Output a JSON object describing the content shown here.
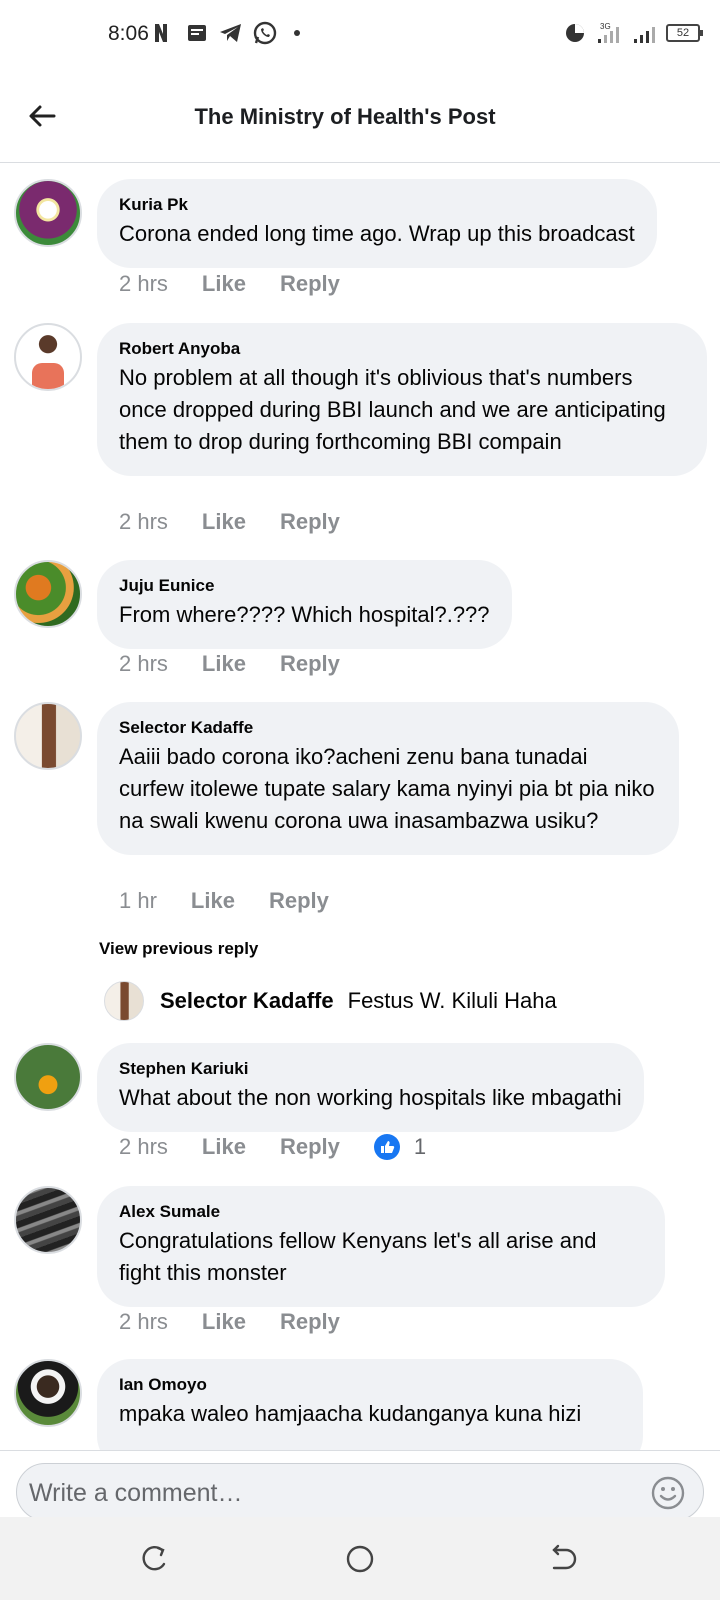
{
  "status_bar": {
    "time": "8:06",
    "battery": "52",
    "network": "3G"
  },
  "header": {
    "title": "The Ministry of Health's Post"
  },
  "comments": [
    {
      "author": "Kuria Pk",
      "text": "Corona ended long time ago. Wrap up this broadcast",
      "time": "2 hrs",
      "like": "Like",
      "reply": "Reply"
    },
    {
      "author": "Robert Anyoba",
      "text": "No problem at all though it's oblivious that's numbers once dropped during BBI launch and we are anticipating them to drop during forthcoming BBI compain",
      "time": "2 hrs",
      "like": "Like",
      "reply": "Reply"
    },
    {
      "author": "Juju Eunice",
      "text": "From where???? Which hospital?.???",
      "time": "2 hrs",
      "like": "Like",
      "reply": "Reply"
    },
    {
      "author": "Selector Kadaffe",
      "text": "Aaiii bado corona iko?acheni zenu bana tunadai curfew itolewe tupate salary kama nyinyi pia bt pia niko na swali kwenu corona uwa inasambazwa usiku?",
      "time": "1 hr",
      "like": "Like",
      "reply": "Reply"
    },
    {
      "author": "Stephen Kariuki",
      "text": "What about the non working hospitals like mbagathi",
      "time": "2 hrs",
      "like": "Like",
      "reply": "Reply",
      "reactions": "1"
    },
    {
      "author": "Alex Sumale",
      "text": "Congratulations fellow Kenyans let's all arise and fight this monster",
      "time": "2 hrs",
      "like": "Like",
      "reply": "Reply"
    },
    {
      "author": "Ian Omoyo",
      "text": "mpaka waleo hamjaacha kudanganya kuna hizi"
    }
  ],
  "thread": {
    "view_previous": "View previous reply",
    "reply_author": "Selector Kadaffe",
    "reply_text": "Festus W. Kiluli Haha"
  },
  "composer": {
    "placeholder": "Write a comment…"
  },
  "colors": {
    "bubble": "#f0f2f5",
    "meta_text": "#8a8d91",
    "like_blue": "#1877f2",
    "divider": "#dadde1"
  }
}
